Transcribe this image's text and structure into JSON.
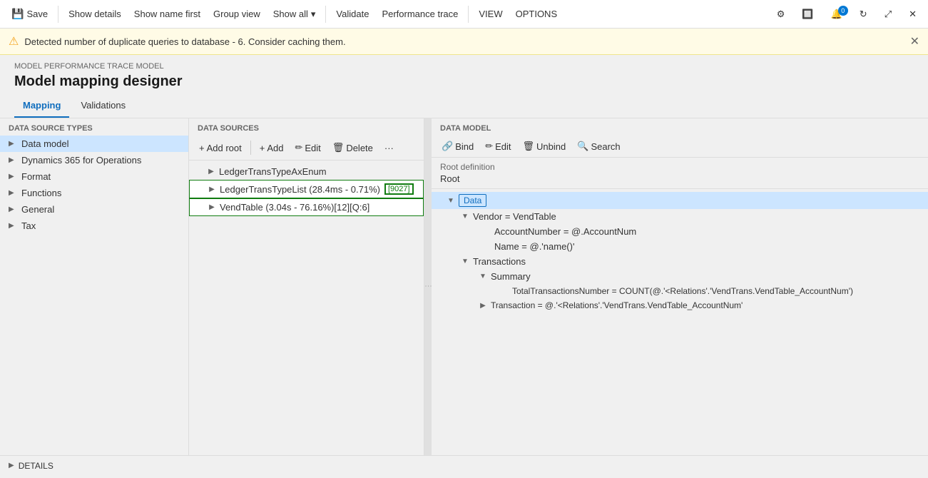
{
  "toolbar": {
    "save_label": "Save",
    "show_details_label": "Show details",
    "show_name_first_label": "Show name first",
    "group_view_label": "Group view",
    "show_all_label": "Show all",
    "validate_label": "Validate",
    "performance_trace_label": "Performance trace",
    "view_label": "VIEW",
    "options_label": "OPTIONS"
  },
  "alert": {
    "message": "Detected number of duplicate queries to database - 6. Consider caching them."
  },
  "breadcrumb": "MODEL PERFORMANCE TRACE MODEL",
  "page_title": "Model mapping designer",
  "tabs": [
    {
      "label": "Mapping",
      "active": true
    },
    {
      "label": "Validations",
      "active": false
    }
  ],
  "left_panel": {
    "header": "DATA SOURCE TYPES",
    "items": [
      {
        "label": "Data model",
        "selected": true
      },
      {
        "label": "Dynamics 365 for Operations",
        "selected": false
      },
      {
        "label": "Format",
        "selected": false
      },
      {
        "label": "Functions",
        "selected": false
      },
      {
        "label": "General",
        "selected": false
      },
      {
        "label": "Tax",
        "selected": false
      }
    ]
  },
  "middle_panel": {
    "header": "DATA SOURCES",
    "toolbar": {
      "add_root": "Add root",
      "add": "Add",
      "edit": "Edit",
      "delete": "Delete"
    },
    "items": [
      {
        "label": "LedgerTransTypeAxEnum",
        "indent": 1,
        "highlighted": false
      },
      {
        "label": "LedgerTransTypeList (28.4ms - 0.71%)",
        "badge": "[9027]",
        "indent": 1,
        "highlighted": true
      },
      {
        "label": "VendTable (3.04s - 76.16%)[12][Q:6]",
        "indent": 1,
        "highlighted": true
      }
    ]
  },
  "right_panel": {
    "header": "DATA MODEL",
    "toolbar": {
      "bind": "Bind",
      "edit": "Edit",
      "unbind": "Unbind",
      "search": "Search"
    },
    "root_definition": "Root definition",
    "root_value": "Root",
    "tree": [
      {
        "label": "Data",
        "indent": 0,
        "type": "node",
        "expand": "collapse",
        "selected": true
      },
      {
        "label": "Vendor = VendTable",
        "indent": 1,
        "expand": "collapse"
      },
      {
        "label": "AccountNumber = @.AccountNum",
        "indent": 2,
        "expand": "none"
      },
      {
        "label": "Name = @.'name()'",
        "indent": 2,
        "expand": "none"
      },
      {
        "label": "Transactions",
        "indent": 1,
        "expand": "collapse"
      },
      {
        "label": "Summary",
        "indent": 2,
        "expand": "collapse"
      },
      {
        "label": "TotalTransactionsNumber = COUNT(@.'<Relations'.'VendTrans.VendTable_AccountNum')",
        "indent": 3,
        "expand": "none"
      },
      {
        "label": "Transaction = @.'<Relations'.'VendTrans.VendTable_AccountNum'",
        "indent": 2,
        "expand": "expand"
      }
    ]
  },
  "details_bar": {
    "label": "DETAILS"
  }
}
